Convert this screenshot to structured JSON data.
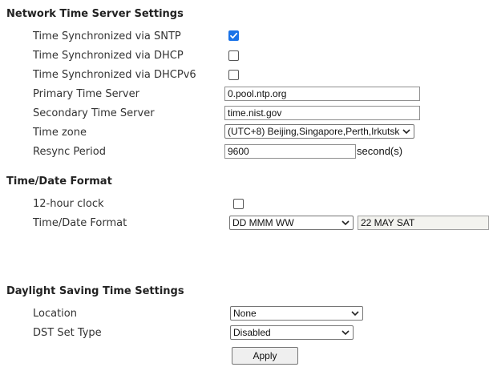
{
  "ntp": {
    "title": "Network Time Server Settings",
    "sntp_label": "Time Synchronized via SNTP",
    "sntp_checked": true,
    "dhcp_label": "Time Synchronized via DHCP",
    "dhcp_checked": false,
    "dhcpv6_label": "Time Synchronized via DHCPv6",
    "dhcpv6_checked": false,
    "primary_label": "Primary Time Server",
    "primary_value": "0.pool.ntp.org",
    "secondary_label": "Secondary Time Server",
    "secondary_value": "time.nist.gov",
    "timezone_label": "Time zone",
    "timezone_value": "(UTC+8) Beijing,Singapore,Perth,Irkutsk",
    "resync_label": "Resync Period",
    "resync_value": "9600",
    "resync_unit": "second(s)"
  },
  "format": {
    "title": "Time/Date Format",
    "hour12_label": "12-hour clock",
    "hour12_checked": false,
    "format_label": "Time/Date Format",
    "format_value": "DD MMM WW",
    "preview_value": "22 MAY SAT"
  },
  "dst": {
    "title": "Daylight Saving Time Settings",
    "location_label": "Location",
    "location_value": "None",
    "type_label": "DST Set Type",
    "type_value": "Disabled"
  },
  "apply_label": "Apply",
  "colors": {
    "checkbox_accent": "#1a73e8"
  },
  "icons": {
    "check": "check-icon",
    "dropdown": "chevron-down-icon"
  }
}
